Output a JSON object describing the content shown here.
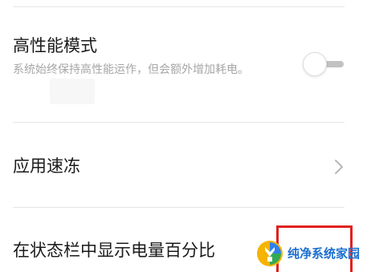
{
  "settings": {
    "high_performance": {
      "title": "高性能模式",
      "description": "系统始终保持高性能运作，但会额外增加耗电。",
      "enabled": false
    },
    "app_freeze": {
      "title": "应用速冻"
    },
    "battery_percent": {
      "title": "在状态栏中显示电量百分比"
    }
  },
  "watermark": {
    "text": "纯净系统家园"
  },
  "colors": {
    "highlight_box": "#e02020",
    "watermark_blue": "#1d6fd0"
  },
  "icons": {
    "chevron": "chevron-right-icon",
    "watermark_logo": "logo-icon"
  }
}
